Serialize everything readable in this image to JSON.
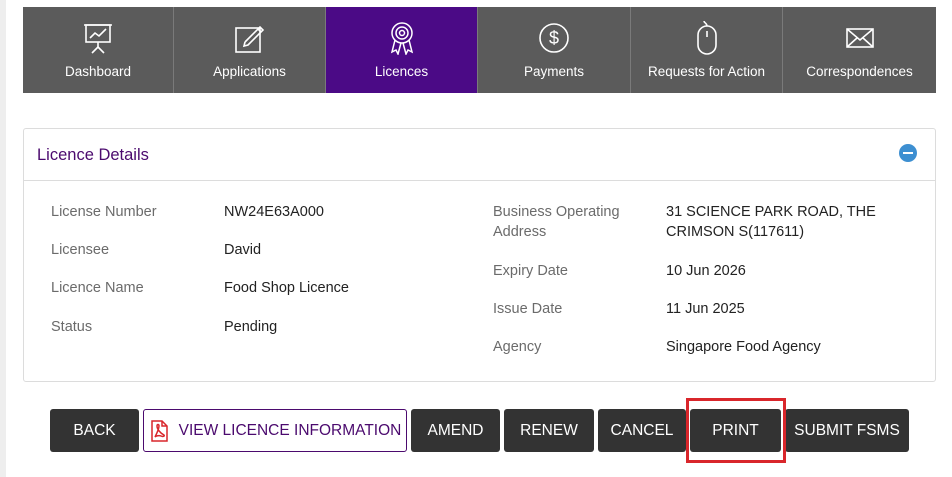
{
  "nav": {
    "tabs": [
      {
        "label": "Dashboard",
        "icon": "presentation-chart-icon",
        "active": false
      },
      {
        "label": "Applications",
        "icon": "edit-form-icon",
        "active": false
      },
      {
        "label": "Licences",
        "icon": "award-ribbon-icon",
        "active": true
      },
      {
        "label": "Payments",
        "icon": "dollar-coin-icon",
        "active": false
      },
      {
        "label": "Requests for Action",
        "icon": "mouse-icon",
        "active": false
      },
      {
        "label": "Correspondences",
        "icon": "envelope-icon",
        "active": false
      }
    ]
  },
  "panel": {
    "title": "Licence Details",
    "left_fields": [
      {
        "label": "License Number",
        "value": "NW24E63A000"
      },
      {
        "label": "Licensee",
        "value": "David"
      },
      {
        "label": "Licence Name",
        "value": "Food Shop Licence"
      },
      {
        "label": "Status",
        "value": "Pending"
      }
    ],
    "right_fields": [
      {
        "label_line1": "Business Operating",
        "label_line2": "Address",
        "value_line1": "31 SCIENCE PARK ROAD, THE",
        "value_line2": "CRIMSON S(117611)"
      },
      {
        "label": "Expiry Date",
        "value": "10 Jun 2026"
      },
      {
        "label": "Issue Date",
        "value": "11 Jun 2025"
      },
      {
        "label": "Agency",
        "value": "Singapore Food Agency"
      }
    ]
  },
  "actions": {
    "back": "BACK",
    "view_info": "VIEW LICENCE INFORMATION",
    "amend": "AMEND",
    "renew": "RENEW",
    "cancel": "CANCEL",
    "print": "PRINT",
    "submit_fsms": "SUBMIT FSMS"
  },
  "colors": {
    "nav_bg": "#5b5b5b",
    "nav_active": "#4b0a86",
    "title_purple": "#4b0a6e",
    "button_dark": "#333333",
    "highlight_red": "#d9262b",
    "collapse_blue": "#3d8fd1"
  }
}
